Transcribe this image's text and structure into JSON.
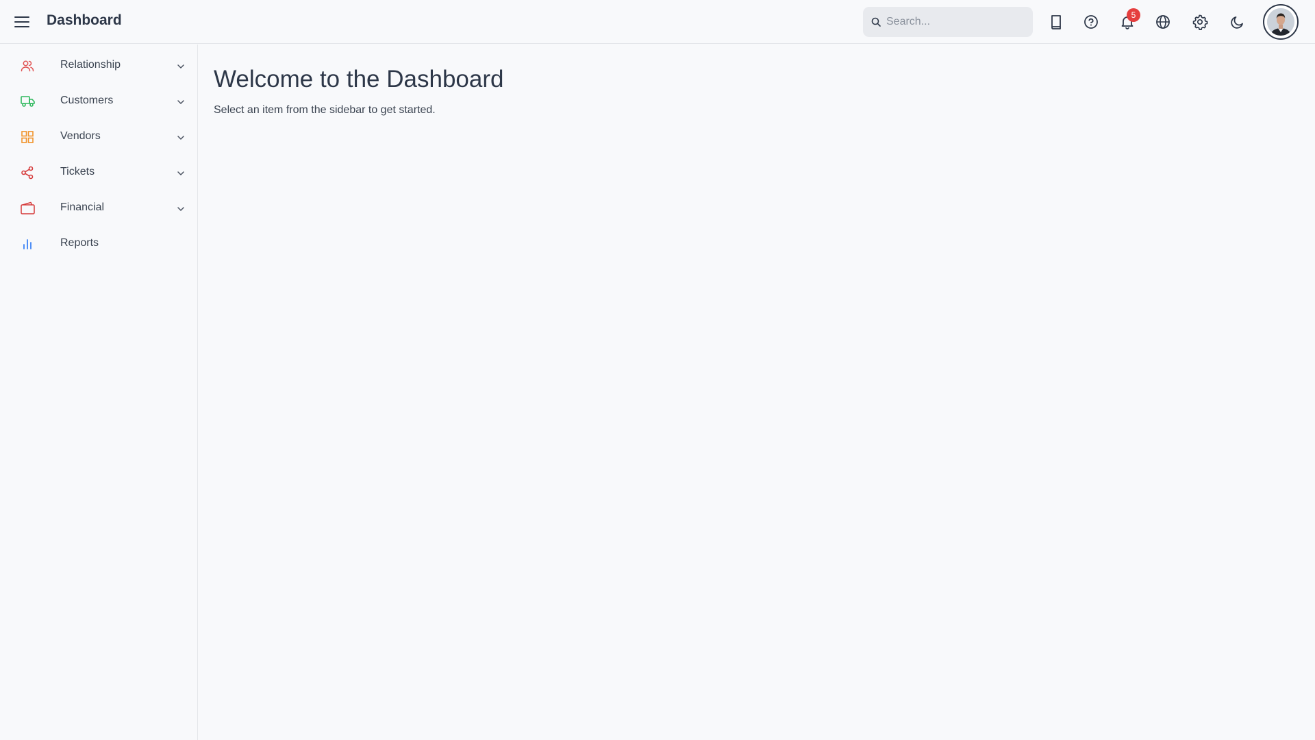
{
  "header": {
    "title": "Dashboard",
    "search": {
      "placeholder": "Search...",
      "value": ""
    },
    "notifications_count": "5",
    "icons": [
      "menu-icon",
      "book-icon",
      "help-icon",
      "bell-icon",
      "globe-icon",
      "gear-icon",
      "moon-icon"
    ]
  },
  "sidebar": {
    "items": [
      {
        "label": "Relationship",
        "icon": "users-icon",
        "color": "#e05252",
        "expandable": true
      },
      {
        "label": "Customers",
        "icon": "truck-icon",
        "color": "#2eb85c",
        "expandable": true
      },
      {
        "label": "Vendors",
        "icon": "grid-icon",
        "color": "#f0932b",
        "expandable": true
      },
      {
        "label": "Tickets",
        "icon": "share-icon",
        "color": "#d63b3b",
        "expandable": true
      },
      {
        "label": "Financial",
        "icon": "wallet-icon",
        "color": "#d63b3b",
        "expandable": true
      },
      {
        "label": "Reports",
        "icon": "bar-chart-icon",
        "color": "#3b82f6",
        "expandable": false
      }
    ]
  },
  "main": {
    "title": "Welcome to the Dashboard",
    "subtitle": "Select an item from the sidebar to get started."
  }
}
